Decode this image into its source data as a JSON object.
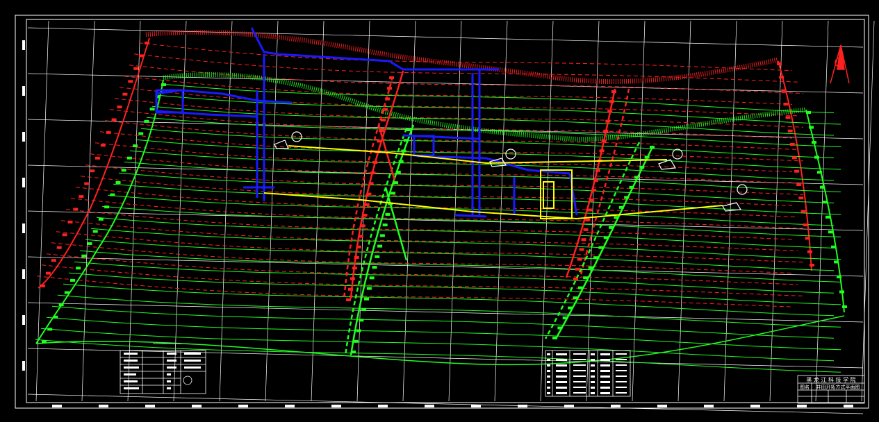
{
  "title_block": {
    "institution": "黑 龙 江 科 技 学 院",
    "drawing_label": "图名",
    "drawing_name": "井田开拓方式平面图"
  },
  "colors": {
    "background": "#000000",
    "grid": "#ffffff",
    "seam_upper": "#ff2020",
    "seam_lower": "#20ff20",
    "workings": "#1a1aff",
    "haulage": "#ffff00",
    "north_arrow": "#ff2020"
  },
  "icons": {
    "north_arrow": "north-arrow-icon"
  }
}
